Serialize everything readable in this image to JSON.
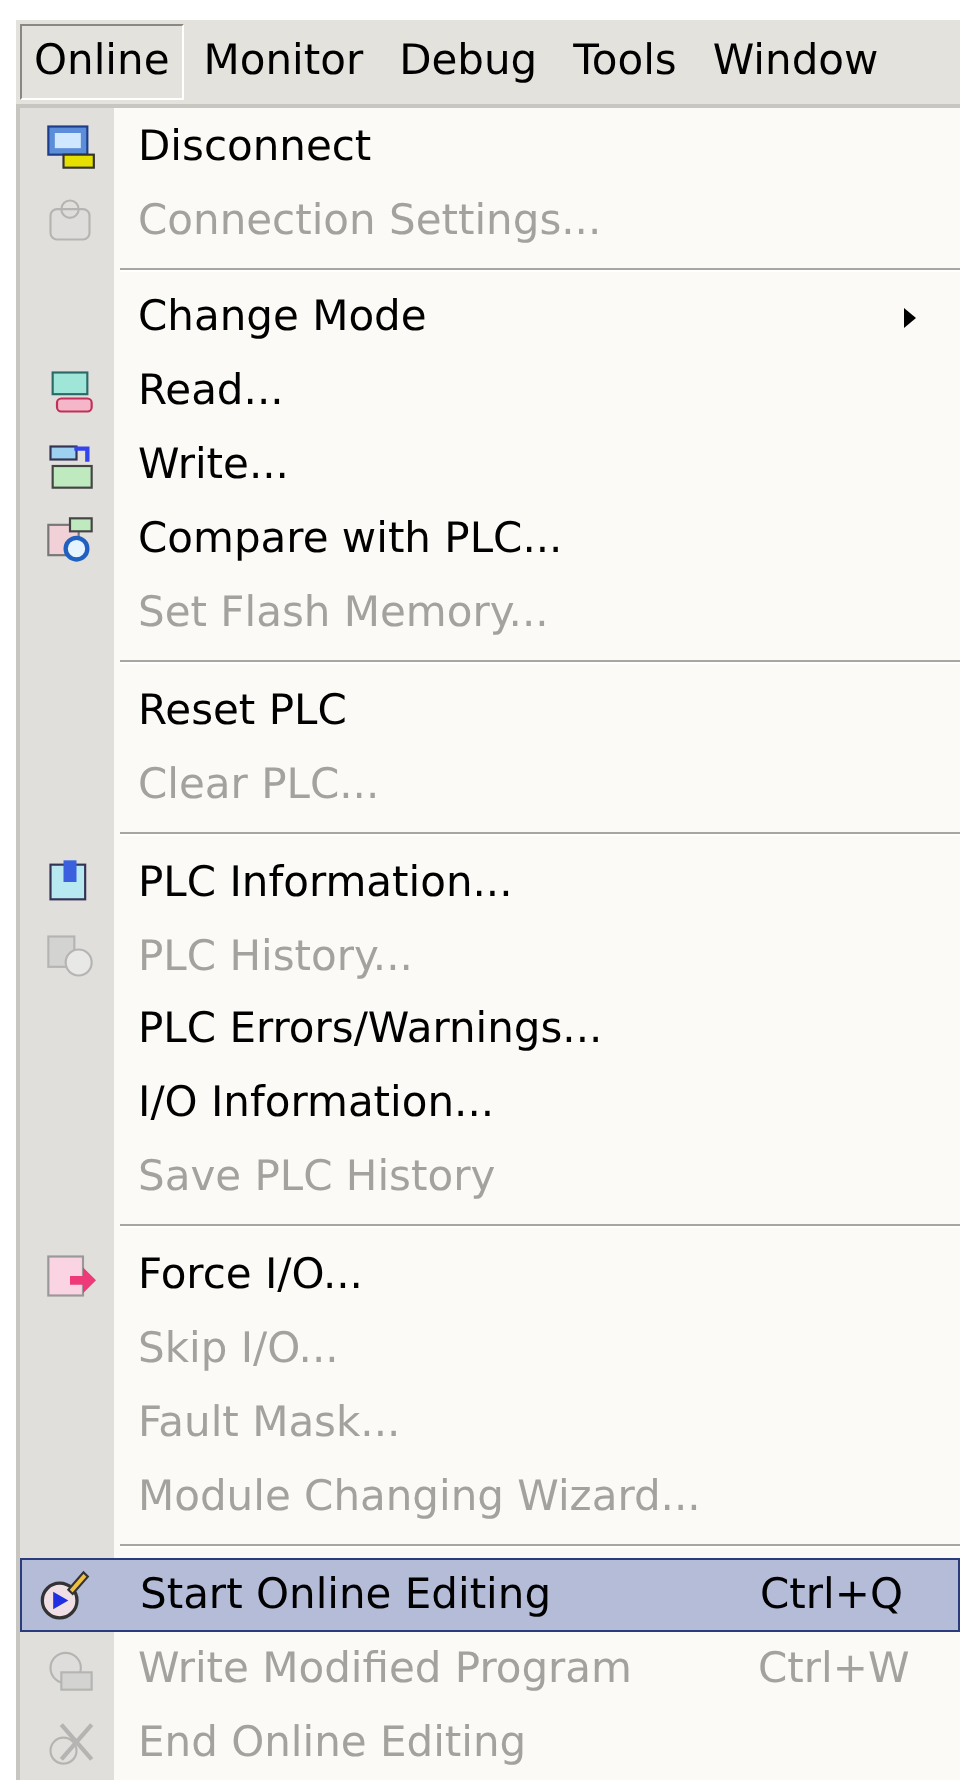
{
  "menubar": [
    {
      "label": "Online",
      "selected": true
    },
    {
      "label": "Monitor",
      "selected": false
    },
    {
      "label": "Debug",
      "selected": false
    },
    {
      "label": "Tools",
      "selected": false
    },
    {
      "label": "Window",
      "selected": false
    }
  ],
  "menu": [
    {
      "kind": "command",
      "label": "Disconnect",
      "disabled": false,
      "selected": false,
      "has_icon": true
    },
    {
      "kind": "command",
      "label": "Connection Settings...",
      "disabled": true,
      "selected": false,
      "has_icon": true
    },
    {
      "kind": "separator"
    },
    {
      "kind": "submenu",
      "label": "Change Mode",
      "disabled": false,
      "selected": false,
      "has_icon": false
    },
    {
      "kind": "command",
      "label": "Read...",
      "disabled": false,
      "selected": false,
      "has_icon": true
    },
    {
      "kind": "command",
      "label": "Write...",
      "disabled": false,
      "selected": false,
      "has_icon": true
    },
    {
      "kind": "command",
      "label": "Compare with PLC...",
      "disabled": false,
      "selected": false,
      "has_icon": true
    },
    {
      "kind": "command",
      "label": "Set Flash Memory...",
      "disabled": true,
      "selected": false,
      "has_icon": false
    },
    {
      "kind": "separator"
    },
    {
      "kind": "command",
      "label": "Reset PLC",
      "disabled": false,
      "selected": false,
      "has_icon": false
    },
    {
      "kind": "command",
      "label": "Clear PLC...",
      "disabled": true,
      "selected": false,
      "has_icon": false
    },
    {
      "kind": "separator"
    },
    {
      "kind": "command",
      "label": "PLC Information...",
      "disabled": false,
      "selected": false,
      "has_icon": true
    },
    {
      "kind": "command",
      "label": "PLC History...",
      "disabled": true,
      "selected": false,
      "has_icon": true
    },
    {
      "kind": "command",
      "label": "PLC Errors/Warnings...",
      "disabled": false,
      "selected": false,
      "has_icon": false
    },
    {
      "kind": "command",
      "label": "I/O Information...",
      "disabled": false,
      "selected": false,
      "has_icon": false
    },
    {
      "kind": "command",
      "label": "Save PLC History",
      "disabled": true,
      "selected": false,
      "has_icon": false
    },
    {
      "kind": "separator"
    },
    {
      "kind": "command",
      "label": "Force I/O...",
      "disabled": false,
      "selected": false,
      "has_icon": true
    },
    {
      "kind": "command",
      "label": "Skip I/O...",
      "disabled": true,
      "selected": false,
      "has_icon": false
    },
    {
      "kind": "command",
      "label": "Fault Mask...",
      "disabled": true,
      "selected": false,
      "has_icon": false
    },
    {
      "kind": "command",
      "label": "Module Changing Wizard...",
      "disabled": true,
      "selected": false,
      "has_icon": false
    },
    {
      "kind": "separator"
    },
    {
      "kind": "command",
      "label": "Start Online Editing",
      "shortcut": "Ctrl+Q",
      "disabled": false,
      "selected": true,
      "has_icon": true
    },
    {
      "kind": "command",
      "label": "Write Modified Program",
      "shortcut": "Ctrl+W",
      "disabled": true,
      "selected": false,
      "has_icon": true
    },
    {
      "kind": "command",
      "label": "End Online Editing",
      "disabled": true,
      "selected": false,
      "has_icon": true
    }
  ]
}
